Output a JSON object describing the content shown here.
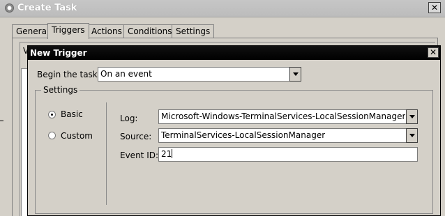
{
  "create_task": {
    "title": "Create Task",
    "tabs": [
      {
        "label": "General"
      },
      {
        "label": "Triggers",
        "active": true
      },
      {
        "label": "Actions"
      },
      {
        "label": "Conditions"
      },
      {
        "label": "Settings"
      }
    ],
    "partial_text": "V"
  },
  "new_trigger": {
    "title": "New Trigger",
    "begin_task_label": "Begin the task:",
    "begin_task_value": "On an event",
    "settings_legend": "Settings",
    "radios": {
      "basic_label": "Basic",
      "custom_label": "Custom",
      "selected": "Basic"
    },
    "log_label": "Log:",
    "log_value": "Microsoft-Windows-TerminalServices-LocalSessionManager/Oper",
    "source_label": "Source:",
    "source_value": "TerminalServices-LocalSessionManager",
    "event_id_label": "Event ID:",
    "event_id_value": "21"
  },
  "icons": {
    "create_task_window": "clock-icon",
    "close": "close-icon",
    "dropdown": "chevron-down-icon"
  }
}
